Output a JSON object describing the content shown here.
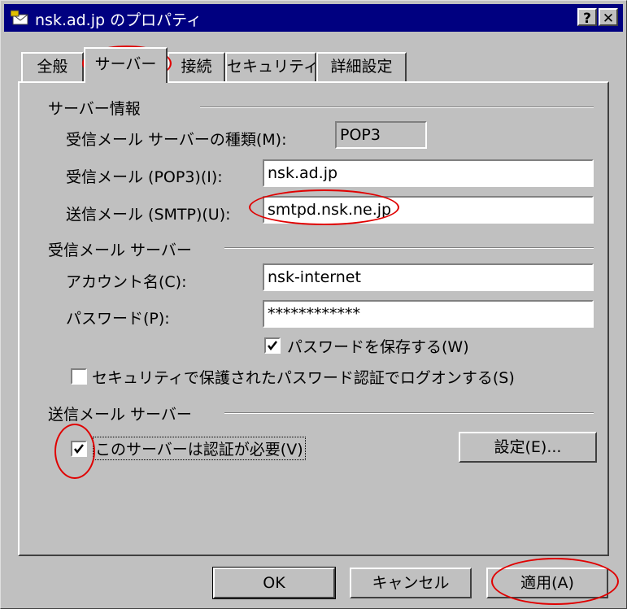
{
  "window": {
    "title": "nsk.ad.jp のプロパティ",
    "help_label": "?",
    "close_label": "✕"
  },
  "tabs": [
    {
      "label": "全般"
    },
    {
      "label": "サーバー",
      "active": true
    },
    {
      "label": "接続"
    },
    {
      "label": "セキュリティ"
    },
    {
      "label": "詳細設定"
    }
  ],
  "server_info": {
    "group_label": "サーバー情報",
    "incoming_type_label": "受信メール サーバーの種類(M):",
    "incoming_type_value": "POP3",
    "incoming_label": "受信メール (POP3)(I):",
    "incoming_value": "nsk.ad.jp",
    "outgoing_label": "送信メール (SMTP)(U):",
    "outgoing_value": "smtpd.nsk.ne.jp"
  },
  "incoming_server": {
    "group_label": "受信メール サーバー",
    "account_label": "アカウント名(C):",
    "account_value": "nsk-internet",
    "password_label": "パスワード(P):",
    "password_value": "************",
    "remember_password_label": "パスワードを保存する(W)",
    "remember_password_checked": true,
    "spa_label": "セキュリティで保護されたパスワード認証でログオンする(S)",
    "spa_checked": false
  },
  "outgoing_server": {
    "group_label": "送信メール サーバー",
    "auth_required_label": "このサーバーは認証が必要(V)",
    "auth_required_checked": true,
    "settings_button": "設定(E)..."
  },
  "buttons": {
    "ok": "OK",
    "cancel": "キャンセル",
    "apply": "適用(A)"
  },
  "colors": {
    "titlebar": "#000080",
    "face": "#c0c0c0",
    "annotation": "#e00000"
  }
}
